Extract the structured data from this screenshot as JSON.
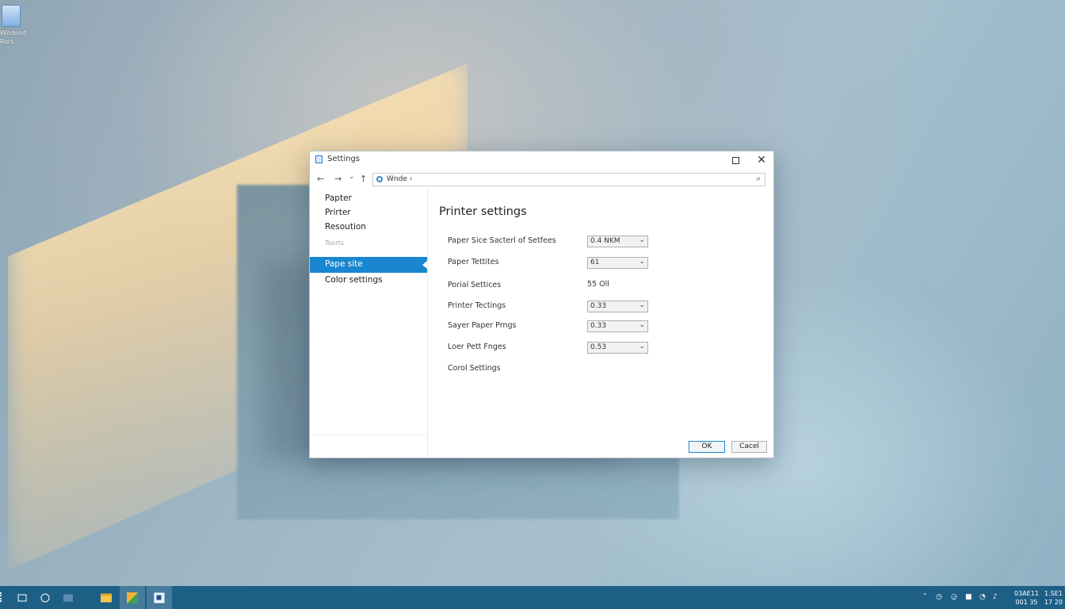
{
  "desktop": {
    "icon_label": "Wndond\nRors"
  },
  "dialog": {
    "title": "Settings",
    "nav": {
      "back": "←",
      "forward": "→",
      "recent": "⌄",
      "up": "↑",
      "address": "Wnde ›",
      "search_glyph": "⌕"
    },
    "window_controls": {
      "close": "✕"
    },
    "sidebar": {
      "items": [
        {
          "label": "Papter"
        },
        {
          "label": "Prirter"
        },
        {
          "label": "Resoution"
        }
      ],
      "subheader": "Toorts",
      "selected": "Pape site",
      "bottom_item": "Color settings"
    },
    "main": {
      "heading": "Printer settings",
      "rows": [
        {
          "label": "Paper Sice Sacterl of Setfees",
          "value": "0.4 NKM",
          "type": "dropdown"
        },
        {
          "label": "Paper Tettites",
          "value": "61",
          "type": "dropdown"
        },
        {
          "label": "Porial Settices",
          "value": "55 Oll",
          "type": "static"
        },
        {
          "label": "Printer Tectings",
          "value": "0.33",
          "type": "dropdown"
        },
        {
          "label": "Sayer Paper Prngs",
          "value": "0.33",
          "type": "dropdown"
        },
        {
          "label": "Loer Pett Fnges",
          "value": "0.53",
          "type": "dropdown"
        },
        {
          "label": "Corol Settings",
          "value": "",
          "type": "link"
        }
      ],
      "chevron": "⌄"
    },
    "buttons": {
      "ok": "OK",
      "cancel": "Cacel"
    }
  },
  "taskbar": {
    "tray": [
      "˄",
      "◷",
      "◶",
      "■",
      "◔",
      "♪"
    ],
    "clock_line1": "03AE11",
    "clock_line2": "001 35",
    "clock_line3": "1.SE1",
    "clock_line4": "17 20"
  },
  "colors": {
    "accent": "#1a86d0",
    "taskbar": "#1e5f86"
  }
}
